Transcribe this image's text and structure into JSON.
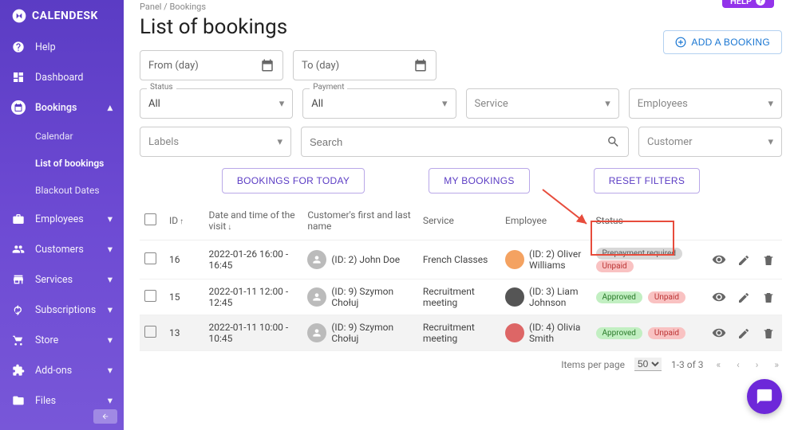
{
  "brand": "CALENDESK",
  "sidebar": {
    "items": [
      {
        "label": "Help",
        "icon": "help"
      },
      {
        "label": "Dashboard",
        "icon": "dashboard"
      },
      {
        "label": "Bookings",
        "icon": "calendar",
        "expanded": true
      },
      {
        "label": "Calendar",
        "sub": true
      },
      {
        "label": "List of bookings",
        "sub": true,
        "active": true
      },
      {
        "label": "Blackout Dates",
        "sub": true
      },
      {
        "label": "Employees",
        "icon": "badge",
        "chevron": true
      },
      {
        "label": "Customers",
        "icon": "people",
        "chevron": true
      },
      {
        "label": "Services",
        "icon": "store",
        "chevron": true
      },
      {
        "label": "Subscriptions",
        "icon": "refresh",
        "chevron": true
      },
      {
        "label": "Store",
        "icon": "cart",
        "chevron": true
      },
      {
        "label": "Add-ons",
        "icon": "extension",
        "chevron": true
      },
      {
        "label": "Files",
        "icon": "folder",
        "chevron": true
      }
    ]
  },
  "help_pill": "HELP",
  "breadcrumb": "Panel / Bookings",
  "page_title": "List of bookings",
  "add_booking_label": "ADD A BOOKING",
  "filters": {
    "from_day": "From (day)",
    "to_day": "To (day)",
    "status_label": "Status",
    "status_value": "All",
    "payment_label": "Payment",
    "payment_value": "All",
    "service_placeholder": "Service",
    "employees_placeholder": "Employees",
    "labels_placeholder": "Labels",
    "search_placeholder": "Search",
    "customer_placeholder": "Customer"
  },
  "buttons": {
    "bookings_today": "BOOKINGS FOR TODAY",
    "my_bookings": "MY BOOKINGS",
    "reset_filters": "RESET FILTERS"
  },
  "table": {
    "headers": {
      "id": "ID",
      "datetime": "Date and time of the visit",
      "customer": "Customer's first and last name",
      "service": "Service",
      "employee": "Employee",
      "status": "Status"
    },
    "rows": [
      {
        "id": "16",
        "datetime": "2022-01-26 16:00 - 16:45",
        "customer": "(ID: 2) John Doe",
        "service": "French Classes",
        "employee": "(ID: 2) Oliver Williams",
        "status_badges": [
          "Prepayment required",
          "Unpaid"
        ]
      },
      {
        "id": "15",
        "datetime": "2022-01-11 12:00 - 12:45",
        "customer": "(ID: 9) Szymon Chołuj",
        "service": "Recruitment meeting",
        "employee": "(ID: 3) Liam Johnson",
        "status_badges": [
          "Approved",
          "Unpaid"
        ]
      },
      {
        "id": "13",
        "datetime": "2022-01-11 10:00 - 10:45",
        "customer": "(ID: 9) Szymon Chołuj",
        "service": "Recruitment meeting",
        "employee": "(ID: 4) Olivia Smith",
        "status_badges": [
          "Approved",
          "Unpaid"
        ]
      }
    ]
  },
  "pagination": {
    "items_per_page_label": "Items per page",
    "items_per_page_value": "50",
    "range": "1-3 of 3"
  }
}
